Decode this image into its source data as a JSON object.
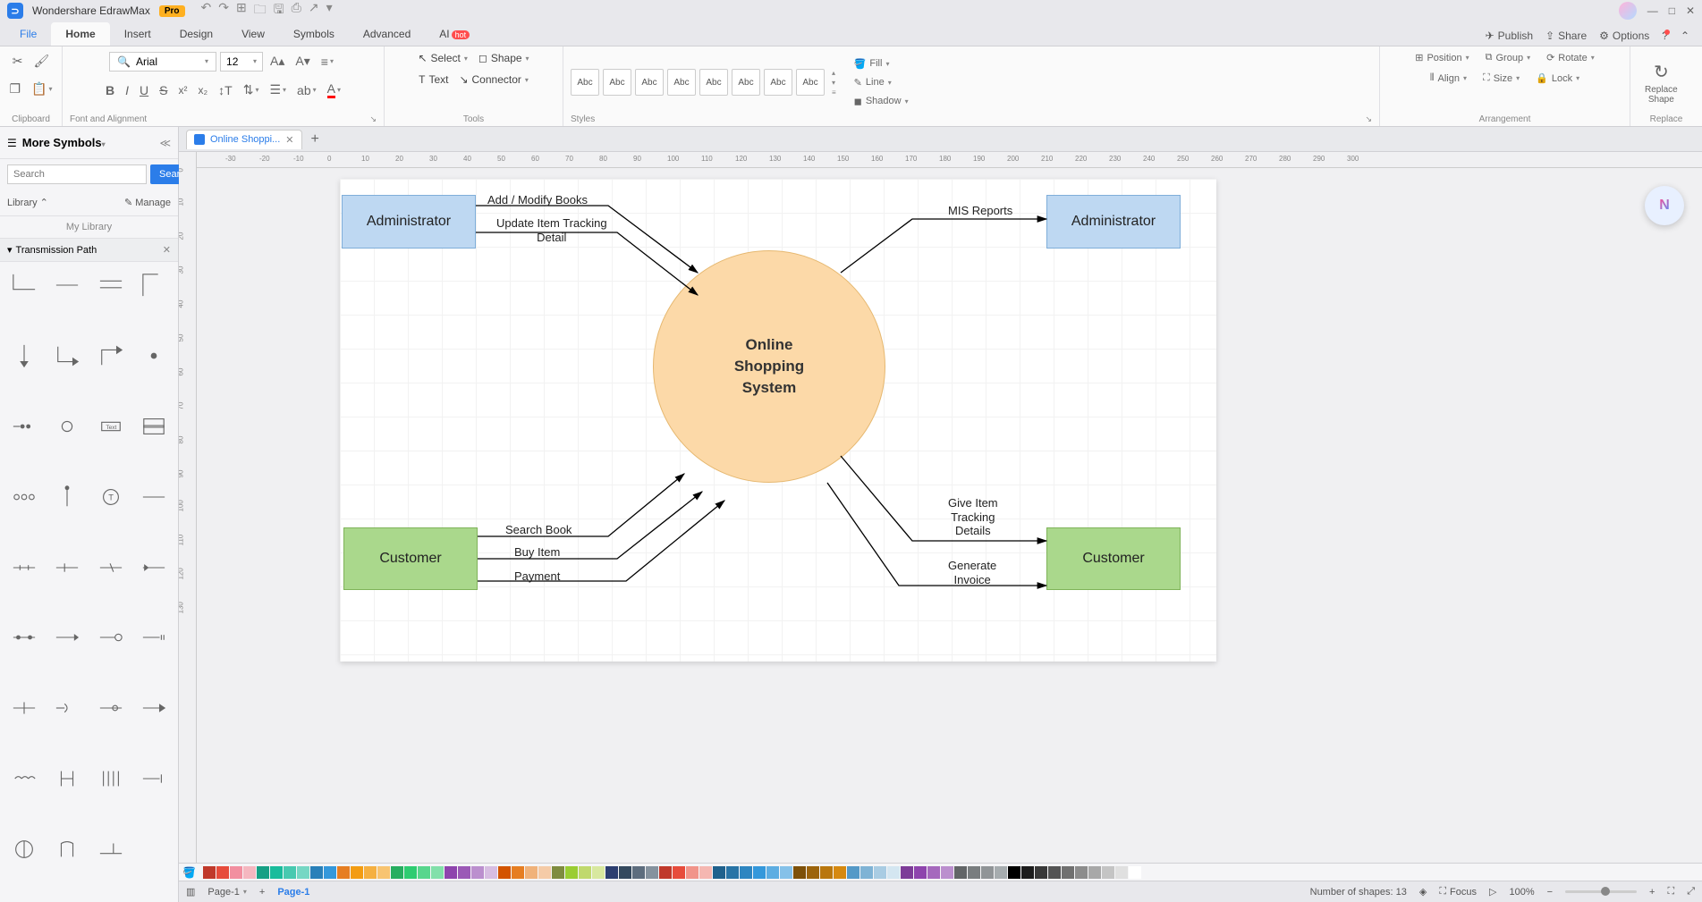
{
  "app": {
    "title": "Wondershare EdrawMax",
    "badge": "Pro"
  },
  "menu": {
    "items": [
      "File",
      "Home",
      "Insert",
      "Design",
      "View",
      "Symbols",
      "Advanced",
      "AI"
    ],
    "active": "Home",
    "ai_badge": "hot",
    "right": {
      "publish": "Publish",
      "share": "Share",
      "options": "Options"
    }
  },
  "ribbon": {
    "clipboard_label": "Clipboard",
    "font": {
      "name": "Arial",
      "size": "12",
      "label": "Font and Alignment"
    },
    "tools": {
      "select": "Select",
      "text": "Text",
      "shape": "Shape",
      "connector": "Connector",
      "label": "Tools"
    },
    "styles": {
      "sample": "Abc",
      "label": "Styles",
      "fill": "Fill",
      "line": "Line",
      "shadow": "Shadow"
    },
    "arrangement": {
      "position": "Position",
      "group": "Group",
      "rotate": "Rotate",
      "align": "Align",
      "size": "Size",
      "lock": "Lock",
      "label": "Arrangement"
    },
    "replace": {
      "button": "Replace\nShape",
      "label": "Replace"
    }
  },
  "sidebar": {
    "title": "More Symbols",
    "search_placeholder": "Search",
    "search_btn": "Search",
    "library": "Library",
    "manage": "Manage",
    "mylib": "My Library",
    "category": "Transmission Path"
  },
  "document": {
    "tab": "Online Shoppi..."
  },
  "ruler": {
    "h": [
      "0",
      "-30",
      "-20",
      "-10",
      "0",
      "10",
      "20",
      "30",
      "40",
      "50",
      "60",
      "70",
      "80",
      "90",
      "100",
      "110",
      "120",
      "130",
      "140",
      "150",
      "160",
      "170",
      "180",
      "190",
      "200",
      "210",
      "220",
      "230",
      "240",
      "250",
      "260",
      "270",
      "280",
      "290",
      "300"
    ],
    "v": [
      "0",
      "10",
      "20",
      "30",
      "40",
      "50",
      "60",
      "70",
      "80",
      "90",
      "100",
      "110",
      "120",
      "130"
    ]
  },
  "diagram": {
    "center": "Online\nShopping\nSystem",
    "admin_left": "Administrator",
    "admin_right": "Administrator",
    "cust_left": "Customer",
    "cust_right": "Customer",
    "labels": {
      "add_modify": "Add / Modify Books",
      "update_track": "Update Item Tracking\nDetail",
      "mis": "MIS Reports",
      "search_book": "Search Book",
      "buy_item": "Buy Item",
      "payment": "Payment",
      "give_track": "Give Item\nTracking\nDetails",
      "gen_invoice": "Generate\nInvoice"
    }
  },
  "palette_colors": [
    "#c0392b",
    "#e74c3c",
    "#f28fa0",
    "#f5b7c0",
    "#16a085",
    "#1abc9c",
    "#48c9b0",
    "#76d7c4",
    "#2980b9",
    "#3498db",
    "#e67e22",
    "#f39c12",
    "#f5b041",
    "#f8c471",
    "#27ae60",
    "#2ecc71",
    "#58d68d",
    "#82e0aa",
    "#8e44ad",
    "#9b59b6",
    "#bb8fce",
    "#d7bde2",
    "#d35400",
    "#e67e22",
    "#f0b27a",
    "#f5cba7",
    "#7f8c3f",
    "#9acd32",
    "#c0d96e",
    "#d8e89f",
    "#2c3e70",
    "#34495e",
    "#5d6d7e",
    "#85929e",
    "#c0392b",
    "#e74c3c",
    "#f1948a",
    "#f5b7b1",
    "#1f618d",
    "#2874a6",
    "#2e86c1",
    "#3498db",
    "#5dade2",
    "#85c1e9",
    "#7e5109",
    "#9c640c",
    "#b9770e",
    "#d68910",
    "#5499c7",
    "#7fb3d5",
    "#a9cce3",
    "#d4e6f1",
    "#7d3c98",
    "#8e44ad",
    "#a569bd",
    "#bb8fce",
    "#626567",
    "#797d7f",
    "#909497",
    "#a6acaf",
    "#000000",
    "#1c1c1c",
    "#383838",
    "#545454",
    "#707070",
    "#8c8c8c",
    "#a8a8a8",
    "#c4c4c4",
    "#e0e0e0",
    "#ffffff"
  ],
  "status": {
    "page_dropdown": "Page-1",
    "page_tab": "Page-1",
    "shapes": "Number of shapes: 13",
    "focus": "Focus",
    "zoom": "100%"
  },
  "ai_float": "N"
}
